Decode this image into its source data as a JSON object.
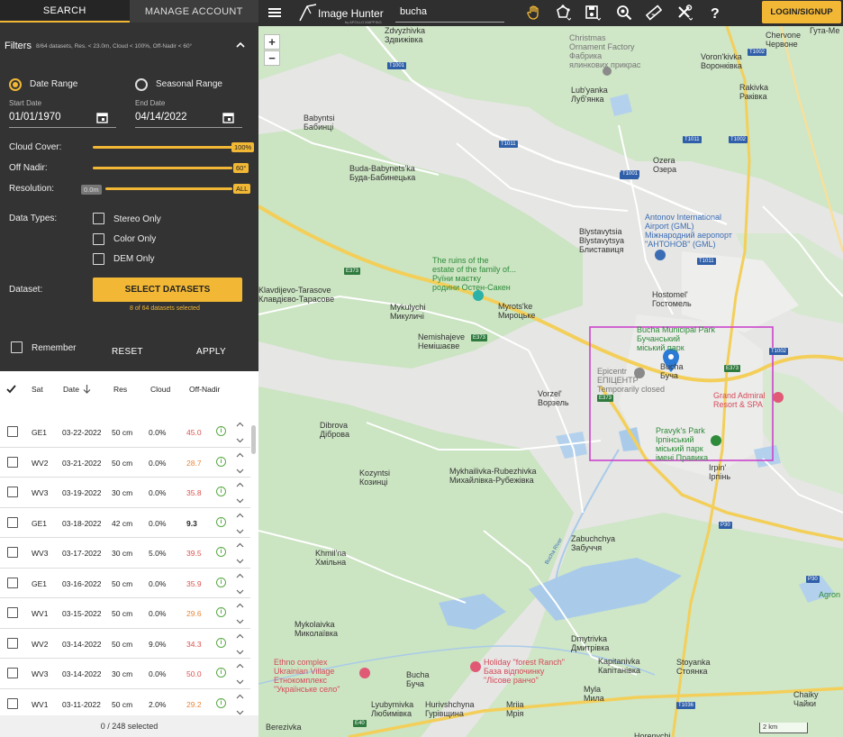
{
  "tabs": {
    "search": "SEARCH",
    "manage": "MANAGE ACCOUNT"
  },
  "filters": {
    "title": "Filters",
    "summary": "8/64 datasets, Res. < 23.0m, Cloud < 100%, Off-Nadir < 60°"
  },
  "date": {
    "range_label": "Date Range",
    "seasonal_label": "Seasonal Range",
    "start_label": "Start Date",
    "start_value": "01/01/1970",
    "end_label": "End Date",
    "end_value": "04/14/2022"
  },
  "sliders": {
    "cloud_label": "Cloud Cover:",
    "cloud_value": "100%",
    "cloud_level": 1.0,
    "nadir_label": "Off Nadir:",
    "nadir_value": "60°",
    "nadir_level": 1.0,
    "res_label": "Resolution:",
    "res_min": "0.0m",
    "res_value": "ALL",
    "res_level": 1.0
  },
  "data_types": {
    "label": "Data Types:",
    "stereo": "Stereo Only",
    "color": "Color Only",
    "dem": "DEM Only"
  },
  "dataset": {
    "label": "Dataset:",
    "button": "SELECT DATASETS",
    "note": "8 of 64 datasets selected"
  },
  "actions": {
    "remember": "Remember",
    "reset": "RESET",
    "apply": "APPLY"
  },
  "table": {
    "headers": {
      "sat": "Sat",
      "date": "Date",
      "res": "Res",
      "cloud": "Cloud",
      "nadir": "Off-Nadir"
    },
    "rows": [
      {
        "sat": "GE1",
        "date": "03-22-2022",
        "res": "50 cm",
        "cloud": "0.0%",
        "nadir": "45.0",
        "nadir_color": "#d9534f"
      },
      {
        "sat": "WV2",
        "date": "03-21-2022",
        "res": "50 cm",
        "cloud": "0.0%",
        "nadir": "28.7",
        "nadir_color": "#e8863a"
      },
      {
        "sat": "WV3",
        "date": "03-19-2022",
        "res": "30 cm",
        "cloud": "0.0%",
        "nadir": "35.8",
        "nadir_color": "#d9534f"
      },
      {
        "sat": "GE1",
        "date": "03-18-2022",
        "res": "42 cm",
        "cloud": "0.0%",
        "nadir": "9.3",
        "nadir_color": "#222222"
      },
      {
        "sat": "WV3",
        "date": "03-17-2022",
        "res": "30 cm",
        "cloud": "5.0%",
        "nadir": "39.5",
        "nadir_color": "#d9534f"
      },
      {
        "sat": "GE1",
        "date": "03-16-2022",
        "res": "50 cm",
        "cloud": "0.0%",
        "nadir": "35.9",
        "nadir_color": "#d9534f"
      },
      {
        "sat": "WV1",
        "date": "03-15-2022",
        "res": "50 cm",
        "cloud": "0.0%",
        "nadir": "29.6",
        "nadir_color": "#e8863a"
      },
      {
        "sat": "WV2",
        "date": "03-14-2022",
        "res": "50 cm",
        "cloud": "9.0%",
        "nadir": "34.3",
        "nadir_color": "#d9534f"
      },
      {
        "sat": "WV3",
        "date": "03-14-2022",
        "res": "30 cm",
        "cloud": "0.0%",
        "nadir": "50.0",
        "nadir_color": "#d9534f"
      },
      {
        "sat": "WV1",
        "date": "03-11-2022",
        "res": "50 cm",
        "cloud": "2.0%",
        "nadir": "29.2",
        "nadir_color": "#e8863a"
      }
    ],
    "footer": "0 / 248 selected"
  },
  "topbar": {
    "brand": "Image Hunter",
    "brand_sub": "by APOLLO MAPPING",
    "search_value": "bucha",
    "login": "LOGIN/SIGNUP",
    "icons": [
      "menu-icon",
      "hand-icon",
      "polygon-draw-icon",
      "save-icon",
      "zoom-search-icon",
      "ruler-icon",
      "tools-icon",
      "help-icon"
    ]
  },
  "map": {
    "zoom_in": "+",
    "zoom_out": "−",
    "scale": "2 km",
    "labels": [
      {
        "t": "Zdvyzhivka\nЗдвижівка",
        "c": ""
      },
      {
        "t": "Christmas\nOrnament Factory\nФабрика\nялинкових прикрас",
        "c": "mgray"
      },
      {
        "t": "Lub'yanka\nЛуб'янка",
        "c": ""
      },
      {
        "t": "Chervone\nЧервоне",
        "c": ""
      },
      {
        "t": "Гута-Ме",
        "c": ""
      },
      {
        "t": "Voron'kivka\nВоронківка",
        "c": ""
      },
      {
        "t": "Rakivka\nРаківка",
        "c": ""
      },
      {
        "t": "Babyntsi\nБабинці",
        "c": ""
      },
      {
        "t": "Ozera\nОзера",
        "c": ""
      },
      {
        "t": "Buda-Babynets'ka\nБуда-Бабинецька",
        "c": ""
      },
      {
        "t": "Antonov International\nAirport (GML)\nМіжнародний аеропорт\n\"АНТОНОВ\" (GML)",
        "c": "mblue"
      },
      {
        "t": "Blystavytsia\nBlystavytsya\nБлиставиця",
        "c": ""
      },
      {
        "t": "The ruins of the\nestate of the family of...\nРуїни маєтку\nродини Остен-Сакен",
        "c": "mgreen"
      },
      {
        "t": "Klavdijevo-Tarasove\nКлавдієво-Тарасове",
        "c": ""
      },
      {
        "t": "Mykulychi\nМикуличі",
        "c": ""
      },
      {
        "t": "Myrots'ke\nМироцьке",
        "c": ""
      },
      {
        "t": "Hostomel'\nГостомель",
        "c": ""
      },
      {
        "t": "Nemishajeve\nНемішаєве",
        "c": ""
      },
      {
        "t": "Bucha Municipal Park\nБучанський\nміський парк",
        "c": "mgreen"
      },
      {
        "t": "Epicentr\nЕПІЦЕНТР\nTemporarily closed",
        "c": "mgray"
      },
      {
        "t": "Bucha\nБуча",
        "c": ""
      },
      {
        "t": "Grand Admiral\nResort & SPA",
        "c": "mred"
      },
      {
        "t": "Vorzel'\nВорзель",
        "c": ""
      },
      {
        "t": "Pravyk's Park\nІрпінський\nміський парк\nімені Правика",
        "c": "mgreen"
      },
      {
        "t": "Dibrova\nДіброва",
        "c": ""
      },
      {
        "t": "Irpin'\nІрпінь",
        "c": ""
      },
      {
        "t": "Kozyntsi\nКозинці",
        "c": ""
      },
      {
        "t": "Mykhailivka-Rubezhivka\nМихайлівка-Рубежівка",
        "c": ""
      },
      {
        "t": "Zabuchchya\nЗабуччя",
        "c": ""
      },
      {
        "t": "Khmil'na\nХмільна",
        "c": ""
      },
      {
        "t": "Mykolaivka\nМиколаївка",
        "c": ""
      },
      {
        "t": "Dmytrivka\nДмитрівка",
        "c": ""
      },
      {
        "t": "Ethno complex\nUkrainian Village\nЕтнокомплекс\n\"Українське село\"",
        "c": "mred"
      },
      {
        "t": "Holiday \"forest Ranch\"\nБаза відпочинку\n\"Лісове ранчо\"",
        "c": "mred"
      },
      {
        "t": "Bucha\nБуча",
        "c": ""
      },
      {
        "t": "Kapitanivka\nКапітанівка",
        "c": ""
      },
      {
        "t": "Stoyanka\nСтоянка",
        "c": ""
      },
      {
        "t": "Lyubymivka\nЛюбимівка",
        "c": ""
      },
      {
        "t": "Hurivshchyna\nГурівщина",
        "c": ""
      },
      {
        "t": "Mriia\nМрія",
        "c": ""
      },
      {
        "t": "Myla\nМила",
        "c": ""
      },
      {
        "t": "Chaiky\nЧайки",
        "c": ""
      },
      {
        "t": "Berezivka",
        "c": ""
      },
      {
        "t": "Horenychi",
        "c": ""
      },
      {
        "t": "Agron",
        "c": "mgreen"
      },
      {
        "t": "Bucha River",
        "c": "mblue"
      }
    ],
    "roads": [
      "T1001",
      "T1002",
      "T1011",
      "T1011",
      "T1002",
      "T1011",
      "T1011",
      "T1001",
      "E373",
      "E373",
      "E373",
      "E373",
      "T1002",
      "P30",
      "P30",
      "E40",
      "T1036"
    ]
  },
  "colors": {
    "accent": "#f2b835",
    "panel": "#333333",
    "selection_box": "#cc44cc"
  }
}
